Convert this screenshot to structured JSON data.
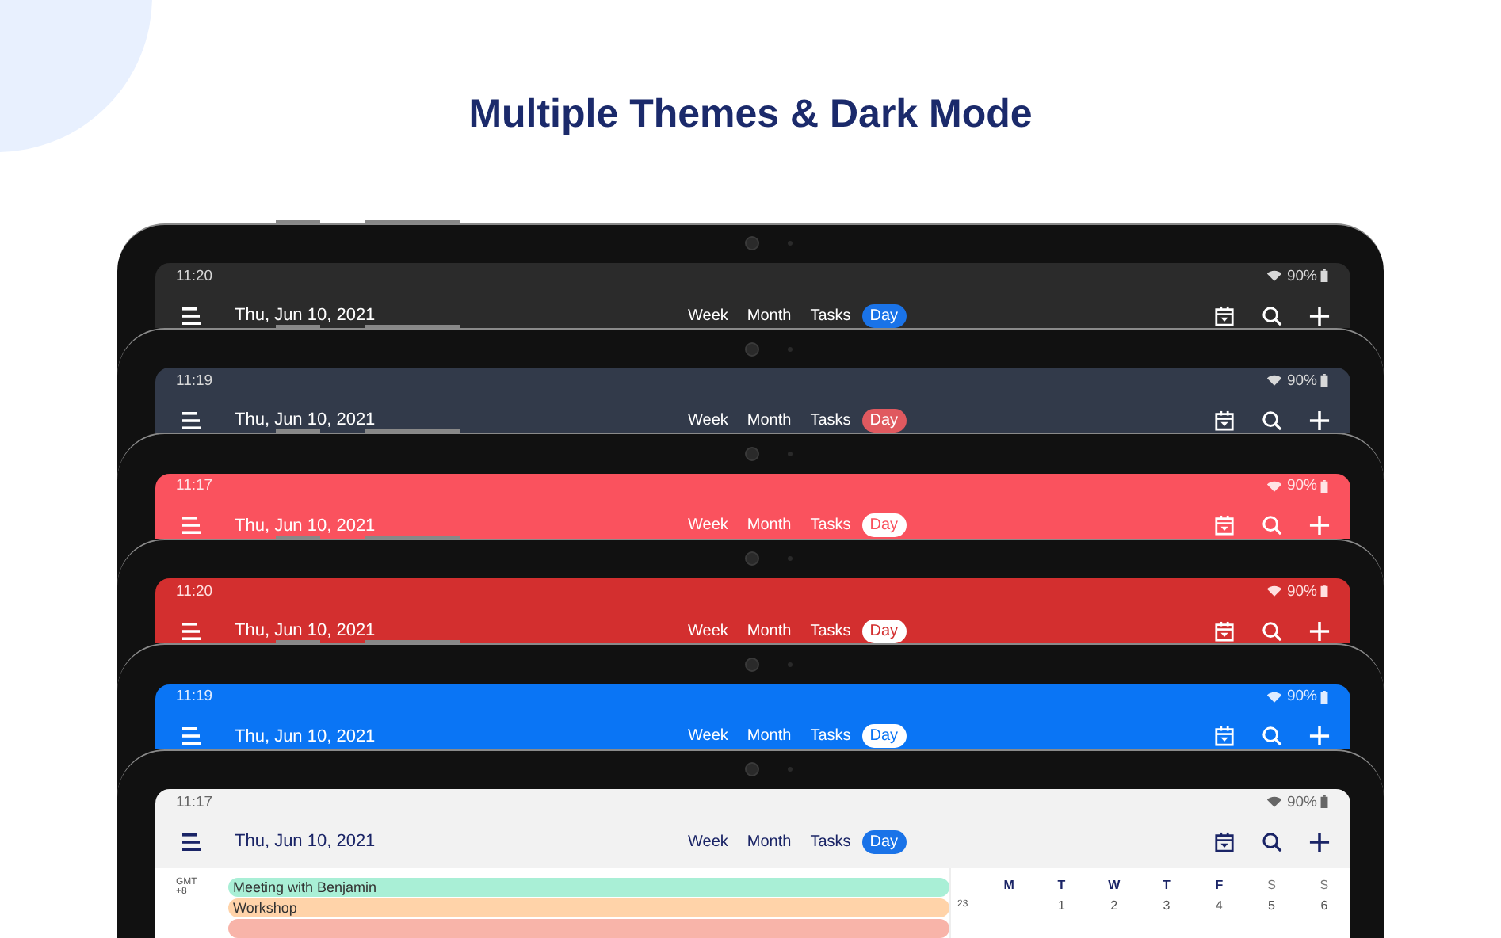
{
  "title": "Multiple Themes & Dark Mode",
  "tablets": [
    {
      "kind": "dark",
      "time": "11:20",
      "battery": "90%",
      "date": "Thu, Jun 10, 2021",
      "tabs": [
        {
          "label": "Week",
          "selected": false
        },
        {
          "label": "Month",
          "selected": false
        },
        {
          "label": "Tasks",
          "selected": false
        },
        {
          "label": "Day",
          "selected": true
        }
      ]
    },
    {
      "kind": "slate",
      "time": "11:19",
      "battery": "90%",
      "date": "Thu, Jun 10, 2021",
      "tabs": [
        {
          "label": "Week",
          "selected": false
        },
        {
          "label": "Month",
          "selected": false
        },
        {
          "label": "Tasks",
          "selected": false
        },
        {
          "label": "Day",
          "selected": true
        }
      ]
    },
    {
      "kind": "coral",
      "time": "11:17",
      "battery": "90%",
      "date": "Thu, Jun 10, 2021",
      "tabs": [
        {
          "label": "Week",
          "selected": false
        },
        {
          "label": "Month",
          "selected": false
        },
        {
          "label": "Tasks",
          "selected": false
        },
        {
          "label": "Day",
          "selected": true
        }
      ]
    },
    {
      "kind": "red",
      "time": "11:20",
      "battery": "90%",
      "date": "Thu, Jun 10, 2021",
      "tabs": [
        {
          "label": "Week",
          "selected": false
        },
        {
          "label": "Month",
          "selected": false
        },
        {
          "label": "Tasks",
          "selected": false
        },
        {
          "label": "Day",
          "selected": true
        }
      ]
    },
    {
      "kind": "blue",
      "time": "11:19",
      "battery": "90%",
      "date": "Thu, Jun 10, 2021",
      "tabs": [
        {
          "label": "Week",
          "selected": false
        },
        {
          "label": "Month",
          "selected": false
        },
        {
          "label": "Tasks",
          "selected": false
        },
        {
          "label": "Day",
          "selected": true
        }
      ]
    },
    {
      "kind": "light",
      "time": "11:17",
      "battery": "90%",
      "date": "Thu, Jun 10, 2021",
      "tabs": [
        {
          "label": "Week",
          "selected": false
        },
        {
          "label": "Month",
          "selected": false
        },
        {
          "label": "Tasks",
          "selected": false
        },
        {
          "label": "Day",
          "selected": true
        }
      ],
      "timezone": [
        "GMT",
        "+8"
      ],
      "events": [
        {
          "title": "Meeting with Benjamin",
          "color": "#a9efd6"
        },
        {
          "title": "Workshop",
          "color": "#ffd3a9"
        },
        {
          "color": "#f8b4a9"
        }
      ],
      "calendar": {
        "week_number": "23",
        "weekdays": [
          {
            "label": "M",
            "weekend": false
          },
          {
            "label": "T",
            "weekend": false
          },
          {
            "label": "W",
            "weekend": false
          },
          {
            "label": "T",
            "weekend": false
          },
          {
            "label": "F",
            "weekend": false
          },
          {
            "label": "S",
            "weekend": true
          },
          {
            "label": "S",
            "weekend": true
          }
        ],
        "days": [
          "1",
          "2",
          "3",
          "4",
          "5",
          "6"
        ]
      }
    }
  ]
}
